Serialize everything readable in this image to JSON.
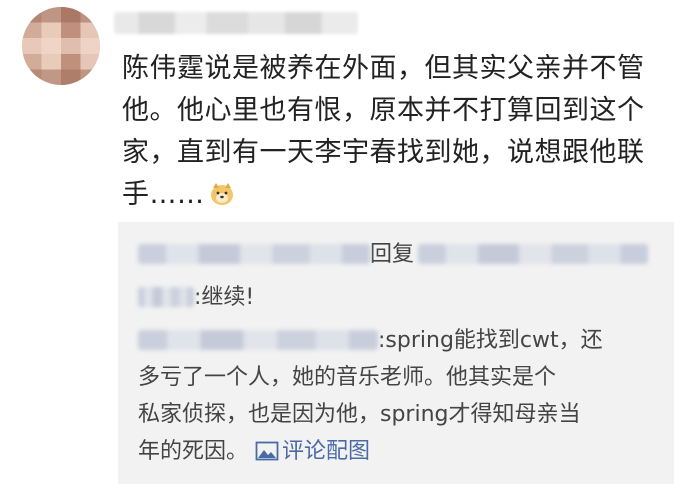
{
  "comment": {
    "lines": [
      "陈伟霆说是被养在外面，但其实父亲并不管",
      "他。他心里也有恨，原本并不打算回到这个",
      "家，直到有一天李宇春找到她，说想跟他联",
      "手……"
    ],
    "emoji_icon": "doge-emoji"
  },
  "replies": {
    "reply1_verb": "回复",
    "reply1_text": ":继续!",
    "reply2_lines": [
      ":spring能找到cwt，还",
      "多亏了一个人，她的音乐老师。他其实是个",
      "私家侦探，也是因为他，spring才得知母亲当",
      "年的死因。"
    ],
    "image_link_label": "评论配图",
    "link_color": "#4a6aa6"
  }
}
